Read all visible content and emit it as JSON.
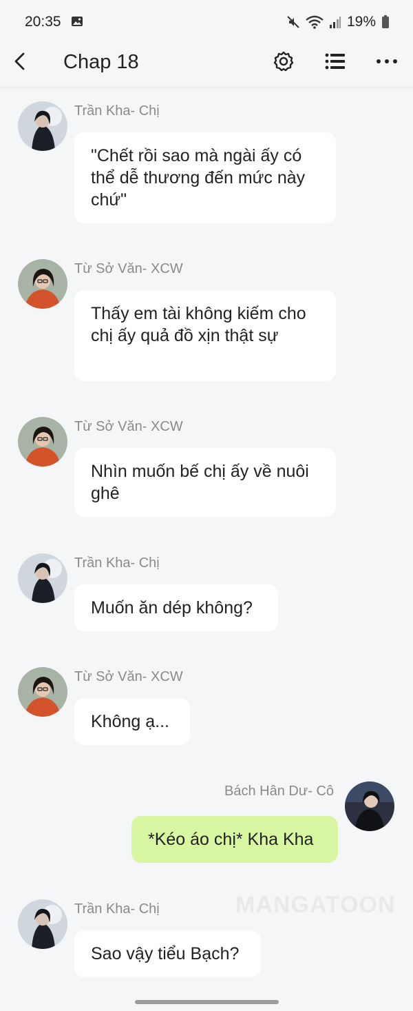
{
  "status_bar": {
    "time": "20:35",
    "battery": "19%"
  },
  "app_bar": {
    "title": "Chap 18"
  },
  "messages": [
    {
      "sender": "Trần Kha- Chị",
      "text": "\"Chết rồi sao mà ngài ấy có thể dễ thương đến mức này chứ\""
    },
    {
      "sender": "Từ Sở Văn- XCW",
      "text": "Thấy em tài không kiếm cho chị ấy quả đồ xịn thật sự"
    },
    {
      "sender": "Từ Sở Văn- XCW",
      "text": "Nhìn muốn bế chị ấy về nuôi ghê"
    },
    {
      "sender": "Trần Kha- Chị",
      "text": "Muốn ăn dép không?"
    },
    {
      "sender": "Từ Sở Văn- XCW",
      "text": "Không ạ..."
    },
    {
      "sender": "Bách Hân Dư- Cô",
      "text": "*Kéo áo chị* Kha Kha"
    },
    {
      "sender": "Trần Kha- Chị",
      "text": "Sao vậy tiểu Bạch?"
    }
  ],
  "watermark": "MANGATOON",
  "colors": {
    "background": "#f5f6f8",
    "bubble": "#ffffff",
    "own_bubble": "#d9f7a2",
    "sender_text": "#8a8a8a"
  },
  "icons": [
    "image-icon",
    "mute-icon",
    "wifi-icon",
    "signal-icon",
    "battery-icon",
    "back-arrow-icon",
    "gear-icon",
    "list-icon",
    "more-icon"
  ]
}
